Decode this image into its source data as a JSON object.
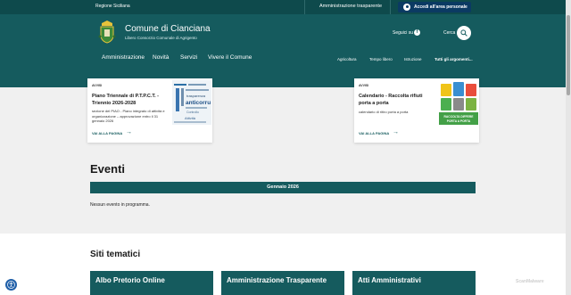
{
  "topbar": {
    "region": "Regione Siciliana",
    "admin_link": "Amministrazione trasparente",
    "login_label": "Accedi all'area personale"
  },
  "header": {
    "title": "Comune di Cianciana",
    "subtitle": "Libero Consorzio Comunale di Agrigento",
    "follow_label": "Seguici su",
    "search_label": "Cerca"
  },
  "main_nav": [
    "Amministrazione",
    "Novità",
    "Servizi",
    "Vivere il Comune"
  ],
  "sub_nav": [
    "Agricoltura",
    "Tempo libero",
    "Istruzione",
    "Tutti gli argomenti..."
  ],
  "cards": [
    {
      "kicker": "AVVISI",
      "title": "Piano Triennale di P.T.P.C.T. - Triennio 2026-2028",
      "description": "sezione del PIAO - Piano integrato di attività e organizzazione – approvazione entro il 31 gennaio 2026",
      "link": "VAI ALLA PAGINA"
    },
    {
      "kicker": "AVVISI",
      "title": "Calendario - Raccolta rifiuti porta a porta",
      "description": "calendario di ritiro porta a porta",
      "link": "VAI ALLA PAGINA"
    }
  ],
  "card1_image_words": [
    "anticorru",
    "Attività",
    "Controllo",
    "trasparenza"
  ],
  "card2_image_caption": [
    "RACCOLTA DIFFERE",
    "PORTA A PORTA"
  ],
  "events": {
    "title": "Eventi",
    "month": "Gennaio 2026",
    "empty_text": "Nessun evento in programma."
  },
  "themes": {
    "title": "Siti tematici",
    "items": [
      "Albo Pretorio Online",
      "Amministrazione Trasparente",
      "Atti Amministrativi"
    ]
  },
  "watermark": "ScanMalware",
  "colors": {
    "primary": "#155b5e",
    "topbar": "#0e4a4c",
    "login_button": "#0b3a63",
    "accessibility": "#1f5fa8"
  },
  "icons": [
    "user-icon",
    "crest-icon",
    "facebook-icon",
    "search-icon",
    "arrow-right-icon",
    "accessibility-icon"
  ]
}
